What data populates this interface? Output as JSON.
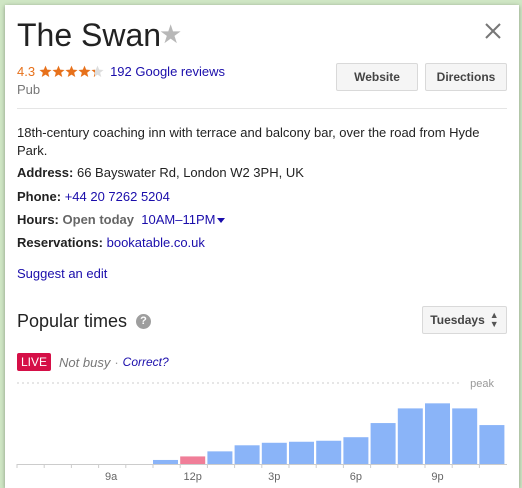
{
  "place": {
    "name": "The Swan",
    "rating": "4.3",
    "stars": 4.3,
    "reviews_link": "192 Google reviews",
    "category": "Pub"
  },
  "actions": {
    "website_label": "Website",
    "directions_label": "Directions"
  },
  "details": {
    "description": "18th-century coaching inn with terrace and balcony bar, over the road from Hyde Park.",
    "address_label": "Address:",
    "address": "66 Bayswater Rd, London W2 3PH, UK",
    "phone_label": "Phone:",
    "phone": "+44 20 7262 5204",
    "hours_label": "Hours:",
    "hours_status": "Open today",
    "hours_value": "10AM–11PM",
    "reservations_label": "Reservations:",
    "reservations": "bookatable.co.uk",
    "suggest_edit": "Suggest an edit"
  },
  "popular_times": {
    "title": "Popular times",
    "day_selected": "Tuesdays",
    "live_label": "LIVE",
    "live_status": "Not busy",
    "separator": "·",
    "correct_link": "Correct?",
    "peak_label": "peak"
  },
  "colors": {
    "bar": "#8ab4f8",
    "live_bar": "#f07e98",
    "live_badge": "#d50f47",
    "link": "#1a0dab",
    "rating": "#e7711b"
  },
  "chart_data": {
    "type": "bar",
    "x": [
      "6a",
      "7a",
      "8a",
      "9a",
      "10a",
      "11a",
      "12p",
      "1p",
      "2p",
      "3p",
      "4p",
      "5p",
      "6p",
      "7p",
      "8p",
      "9p",
      "10p",
      "11p"
    ],
    "tick_labels": [
      "9a",
      "12p",
      "3p",
      "6p",
      "9p"
    ],
    "values": [
      0,
      0,
      0,
      0,
      0,
      8,
      15,
      25,
      37,
      42,
      44,
      46,
      53,
      81,
      110,
      120,
      110,
      77
    ],
    "live_index": 6,
    "ylim": [
      0,
      180
    ],
    "grid": false
  }
}
